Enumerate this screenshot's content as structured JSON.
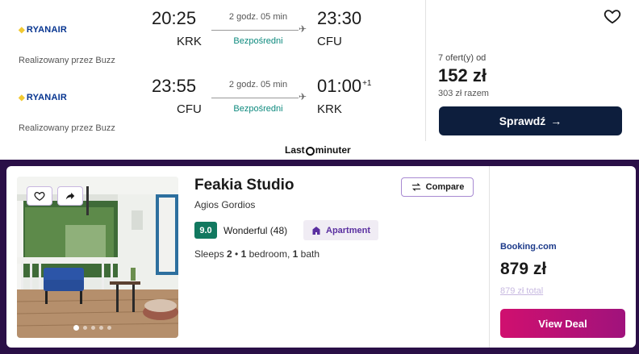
{
  "flight": {
    "legs": [
      {
        "airline": "RYANAIR",
        "operated_by": "Realizowany przez Buzz",
        "depart_time": "20:25",
        "depart_code": "KRK",
        "duration": "2 godz. 05 min",
        "stops": "Bezpośredni",
        "arrive_time": "23:30",
        "arrive_code": "CFU",
        "day_offset": ""
      },
      {
        "airline": "RYANAIR",
        "operated_by": "Realizowany przez Buzz",
        "depart_time": "23:55",
        "depart_code": "CFU",
        "duration": "2 godz. 05 min",
        "stops": "Bezpośredni",
        "arrive_time": "01:00",
        "arrive_code": "KRK",
        "day_offset": "+1"
      }
    ],
    "offers_label": "7 ofert(y) od",
    "price": "152 zł",
    "total_label": "303 zł razem",
    "cta_label": "Sprawdź",
    "cta_arrow": "→",
    "provider_logo_left": "Last",
    "provider_logo_right": "minuter"
  },
  "hotel": {
    "name": "Feakia Studio",
    "location": "Agios Gordios",
    "rating": "9.0",
    "rating_text": "Wonderful (48)",
    "type": "Apartment",
    "sleeps_prefix": "Sleeps ",
    "sleeps_count": "2",
    "sleeps_sep": " • ",
    "bedrooms_count": "1",
    "bedrooms_label": " bedroom, ",
    "baths_count": "1",
    "baths_label": " bath",
    "compare_label": "Compare",
    "deal_provider": "Booking.com",
    "deal_price": "879 zł",
    "deal_total": "879 zł total",
    "view_deal_label": "View Deal",
    "photo_count": 5,
    "photo_index": 1
  },
  "colors": {
    "navy_button": "#0d1e3d",
    "page_band": "#2a0f47",
    "deal_button_from": "#d0106f",
    "deal_button_to": "#a0127c",
    "rating_green": "#11785f",
    "direct_teal": "#0e8a7e"
  }
}
